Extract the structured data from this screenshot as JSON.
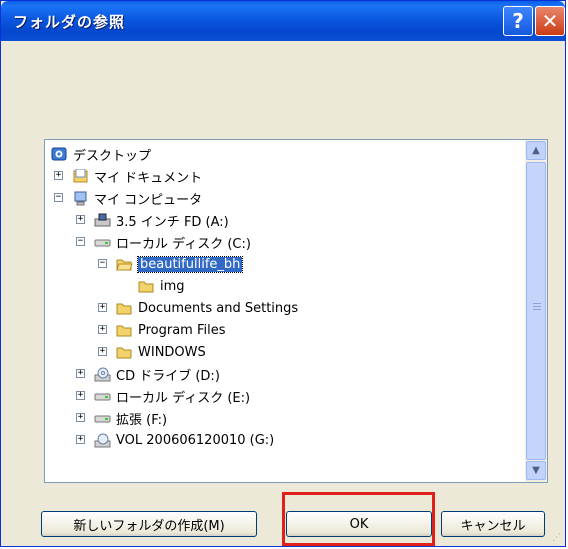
{
  "window": {
    "title": "フォルダの参照",
    "help_label": "?",
    "close_label": "✕"
  },
  "tree": {
    "nodes": [
      {
        "label": "デスクトップ",
        "icon": "desktop-icon",
        "expander": ""
      },
      {
        "label": "マイ ドキュメント",
        "icon": "my-documents-icon",
        "expander": "+"
      },
      {
        "label": "マイ コンピュータ",
        "icon": "my-computer-icon",
        "expander": "−"
      },
      {
        "label": "3.5 インチ FD (A:)",
        "icon": "floppy-drive-icon",
        "expander": "+"
      },
      {
        "label": "ローカル ディスク (C:)",
        "icon": "hard-disk-icon",
        "expander": "−"
      },
      {
        "label": "beautifullife_bh",
        "icon": "open-folder-icon",
        "expander": "−",
        "selected": true
      },
      {
        "label": "img",
        "icon": "folder-icon",
        "expander": ""
      },
      {
        "label": "Documents and Settings",
        "icon": "folder-icon",
        "expander": "+"
      },
      {
        "label": "Program Files",
        "icon": "folder-icon",
        "expander": "+"
      },
      {
        "label": "WINDOWS",
        "icon": "folder-icon",
        "expander": "+"
      },
      {
        "label": "CD ドライブ (D:)",
        "icon": "cd-drive-icon",
        "expander": "+"
      },
      {
        "label": "ローカル ディスク (E:)",
        "icon": "hard-disk-icon",
        "expander": "+"
      },
      {
        "label": "拡張 (F:)",
        "icon": "hard-disk-icon",
        "expander": "+"
      },
      {
        "label": "VOL 200606120010 (G:)",
        "icon": "cd-drive-icon",
        "expander": "+"
      }
    ]
  },
  "buttons": {
    "new_folder": "新しいフォルダの作成(M)",
    "ok": "OK",
    "cancel": "キャンセル"
  },
  "scrollbar": {
    "up": "▲",
    "down": "▼"
  },
  "colors": {
    "selection": "#316ac5",
    "highlight_box": "#e0201b",
    "titlebar": "#0a5fe8"
  }
}
